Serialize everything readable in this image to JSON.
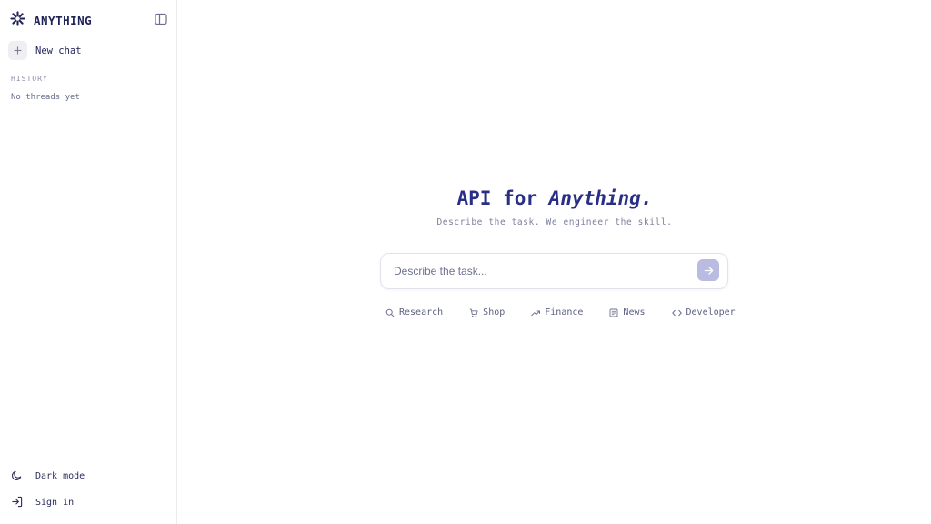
{
  "app": {
    "name": "ANYTHING",
    "brand_color": "#1f2358",
    "accent_color": "#2a2f86"
  },
  "sidebar": {
    "new_chat_label": "New chat",
    "history_title": "HISTORY",
    "history_empty": "No threads yet",
    "footer": {
      "dark_mode_label": "Dark mode",
      "sign_in_label": "Sign in"
    }
  },
  "main": {
    "title_prefix": "API for ",
    "title_emphasis": "Anything.",
    "subtitle": "Describe the task. We engineer the skill.",
    "search": {
      "placeholder": "Describe the task...",
      "value": ""
    },
    "categories": [
      {
        "label": "Research",
        "icon": "search-icon"
      },
      {
        "label": "Shop",
        "icon": "cart-icon"
      },
      {
        "label": "Finance",
        "icon": "trending-up-icon"
      },
      {
        "label": "News",
        "icon": "newspaper-icon"
      },
      {
        "label": "Developer",
        "icon": "code-icon"
      }
    ]
  }
}
